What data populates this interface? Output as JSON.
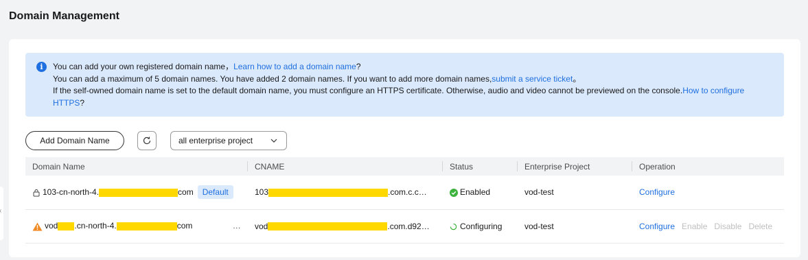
{
  "page": {
    "title": "Domain Management"
  },
  "notice": {
    "line1_text": "You can add your own registered domain name，",
    "line1_link": "Learn how to add a domain name",
    "line1_end": "?",
    "line2_text": "You can add a maximum of 5 domain names. You have added 2 domain names. If you want to add more domain names,",
    "line2_link": "submit a service ticket",
    "line2_end": "。",
    "line3_text": "If the self-owned domain name is set to the default domain name, you must configure an HTTPS certificate. Otherwise, audio and video cannot be previewed on the console.",
    "line3_link": "How to configure HTTPS",
    "line3_end": "?"
  },
  "toolbar": {
    "add_label": "Add Domain Name",
    "project_select_value": "all enterprise project"
  },
  "table": {
    "columns": [
      "Domain Name",
      "CNAME",
      "Status",
      "Enterprise Project",
      "Operation"
    ],
    "rows": [
      {
        "domain_prefix": "103-cn-north-4.",
        "domain_suffix": "com",
        "badge": "Default",
        "cname_prefix": "103",
        "cname_suffix": ".com.c.c…",
        "status": "Enabled",
        "project": "vod-test",
        "ops": [
          "Configure"
        ]
      },
      {
        "domain_prefix": "vod",
        "domain_mid": ".cn-north-4.",
        "domain_suffix": "com",
        "more": "…",
        "cname_prefix": "vod",
        "cname_suffix": ".com.d92…",
        "status": "Configuring",
        "project": "vod-test",
        "ops": [
          "Configure",
          "Enable",
          "Disable",
          "Delete"
        ]
      }
    ]
  },
  "colors": {
    "accent": "#1e6fe0",
    "success": "#3db33d",
    "warning": "#f08a24",
    "redaction": "#ffd800"
  }
}
